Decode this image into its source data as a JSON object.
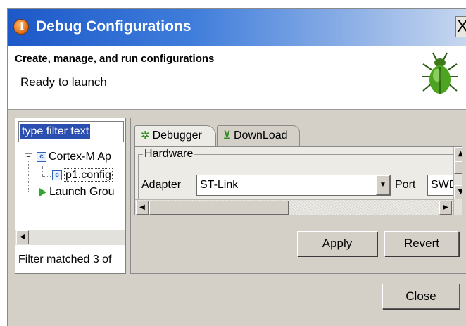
{
  "window": {
    "title": "Debug Configurations",
    "close_glyph": "X"
  },
  "header": {
    "title": "Create, manage, and run configurations",
    "message": "Ready to launch",
    "icon": "bug-icon"
  },
  "left_panel": {
    "filter_value": "type filter text",
    "tree": [
      {
        "label": "Cortex-M Ap",
        "icon": "c-config-icon",
        "expander": "−",
        "level": 0
      },
      {
        "label": "p1.config",
        "icon": "c-config-icon",
        "level": 1
      },
      {
        "label": "Launch Grou",
        "icon": "play-icon",
        "level": 0
      }
    ],
    "status": "Filter matched 3 of"
  },
  "tabs": [
    {
      "label": "Debugger",
      "icon": "bug-gear-icon",
      "active": true
    },
    {
      "label": "DownLoad",
      "icon": "download-icon",
      "active": false
    }
  ],
  "hardware": {
    "group_label": "Hardware",
    "adapter_label": "Adapter",
    "adapter_value": "ST-Link",
    "port_label": "Port",
    "port_value": "SWD"
  },
  "buttons": {
    "apply": "Apply",
    "revert": "Revert",
    "close": "Close"
  }
}
